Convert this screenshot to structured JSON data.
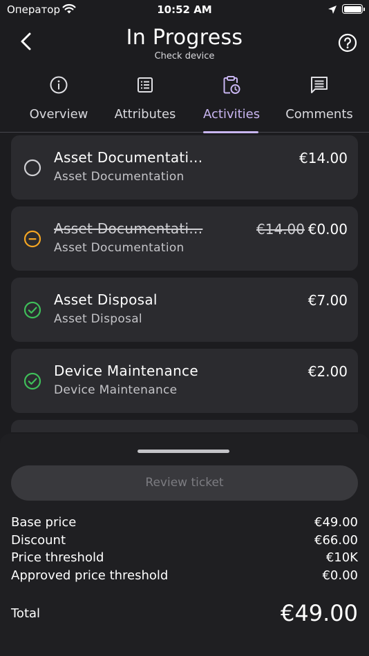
{
  "status_bar": {
    "carrier": "Оператор",
    "time": "10:52 AM"
  },
  "header": {
    "title": "In Progress",
    "subtitle": "Check device",
    "back_icon": "chevron-left-icon",
    "help_icon": "help-circle-icon"
  },
  "tabs": [
    {
      "label": "Overview",
      "icon": "info-icon",
      "active": false
    },
    {
      "label": "Attributes",
      "icon": "list-icon",
      "active": false
    },
    {
      "label": "Activities",
      "icon": "clipboard-clock-icon",
      "active": true
    },
    {
      "label": "Comments",
      "icon": "comment-icon",
      "active": false
    }
  ],
  "activities": [
    {
      "title": "Asset Documentati...",
      "subtitle": "Asset Documentation",
      "price": "€14.00",
      "old_price": "",
      "status": "pending",
      "strikethrough": false
    },
    {
      "title": "Asset Documentati...",
      "subtitle": "Asset Documentation",
      "price": "€0.00",
      "old_price": "€14.00",
      "status": "removed",
      "strikethrough": true
    },
    {
      "title": "Asset Disposal",
      "subtitle": "Asset Disposal",
      "price": "€7.00",
      "old_price": "",
      "status": "done",
      "strikethrough": false
    },
    {
      "title": "Device Maintenance",
      "subtitle": "Device Maintenance",
      "price": "€2.00",
      "old_price": "",
      "status": "done",
      "strikethrough": false
    }
  ],
  "colors": {
    "accent": "#c9b6f2",
    "done": "#3fbf5a",
    "removed": "#f5a623",
    "pending": "#d0d0d4"
  },
  "bottom_sheet": {
    "review_button": "Review ticket",
    "summary": [
      {
        "label": "Base price",
        "value": "€49.00"
      },
      {
        "label": "Discount",
        "value": "€66.00"
      },
      {
        "label": "Price threshold",
        "value": "€10K"
      },
      {
        "label": "Approved price threshold",
        "value": "€0.00"
      }
    ],
    "total_label": "Total",
    "total_value": "€49.00"
  }
}
